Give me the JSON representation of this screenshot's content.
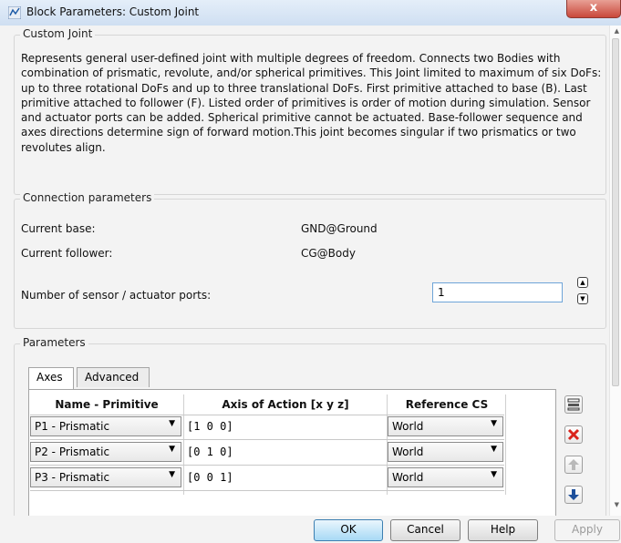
{
  "window": {
    "title": "Block Parameters: Custom Joint",
    "close_glyph": "x"
  },
  "description_group": {
    "legend": "Custom Joint",
    "text": "Represents general user-defined joint with multiple degrees of freedom. Connects two Bodies with combination of prismatic, revolute, and/or spherical primitives. This Joint limited to maximum of six DoFs: up to three rotational DoFs and up to three translational DoFs. First primitive attached to base (B). Last primitive attached to follower (F). Listed order of primitives is order of motion during simulation. Sensor and actuator ports can be added. Spherical primitive cannot be actuated. Base-follower sequence and axes directions determine sign of forward motion.This joint becomes singular if two prismatics or two revolutes align."
  },
  "connection": {
    "legend": "Connection parameters",
    "base_label": "Current base:",
    "base_value": "GND@Ground",
    "follower_label": "Current follower:",
    "follower_value": "CG@Body",
    "ports_label": "Number of sensor / actuator ports:",
    "ports_value": "1"
  },
  "parameters": {
    "legend": "Parameters",
    "tabs": [
      {
        "label": "Axes",
        "active": true
      },
      {
        "label": "Advanced",
        "active": false
      }
    ],
    "columns": [
      "Name - Primitive",
      "Axis of Action [x y z]",
      "Reference CS"
    ],
    "rows": [
      {
        "primitive": "P1 - Prismatic",
        "axis": "[1 0 0]",
        "reference": "World"
      },
      {
        "primitive": "P2 - Prismatic",
        "axis": "[0 1 0]",
        "reference": "World"
      },
      {
        "primitive": "P3 - Prismatic",
        "axis": "[0 0 1]",
        "reference": "World"
      }
    ],
    "side_buttons": [
      "insert-row-icon",
      "delete-row-icon",
      "move-up-icon",
      "move-down-icon"
    ]
  },
  "buttons": {
    "ok": "OK",
    "cancel": "Cancel",
    "help": "Help",
    "apply": "Apply"
  },
  "colors": {
    "delete": "#d9231b",
    "move_down": "#1d4f9b",
    "move_up_disabled": "#b9b9b9"
  }
}
